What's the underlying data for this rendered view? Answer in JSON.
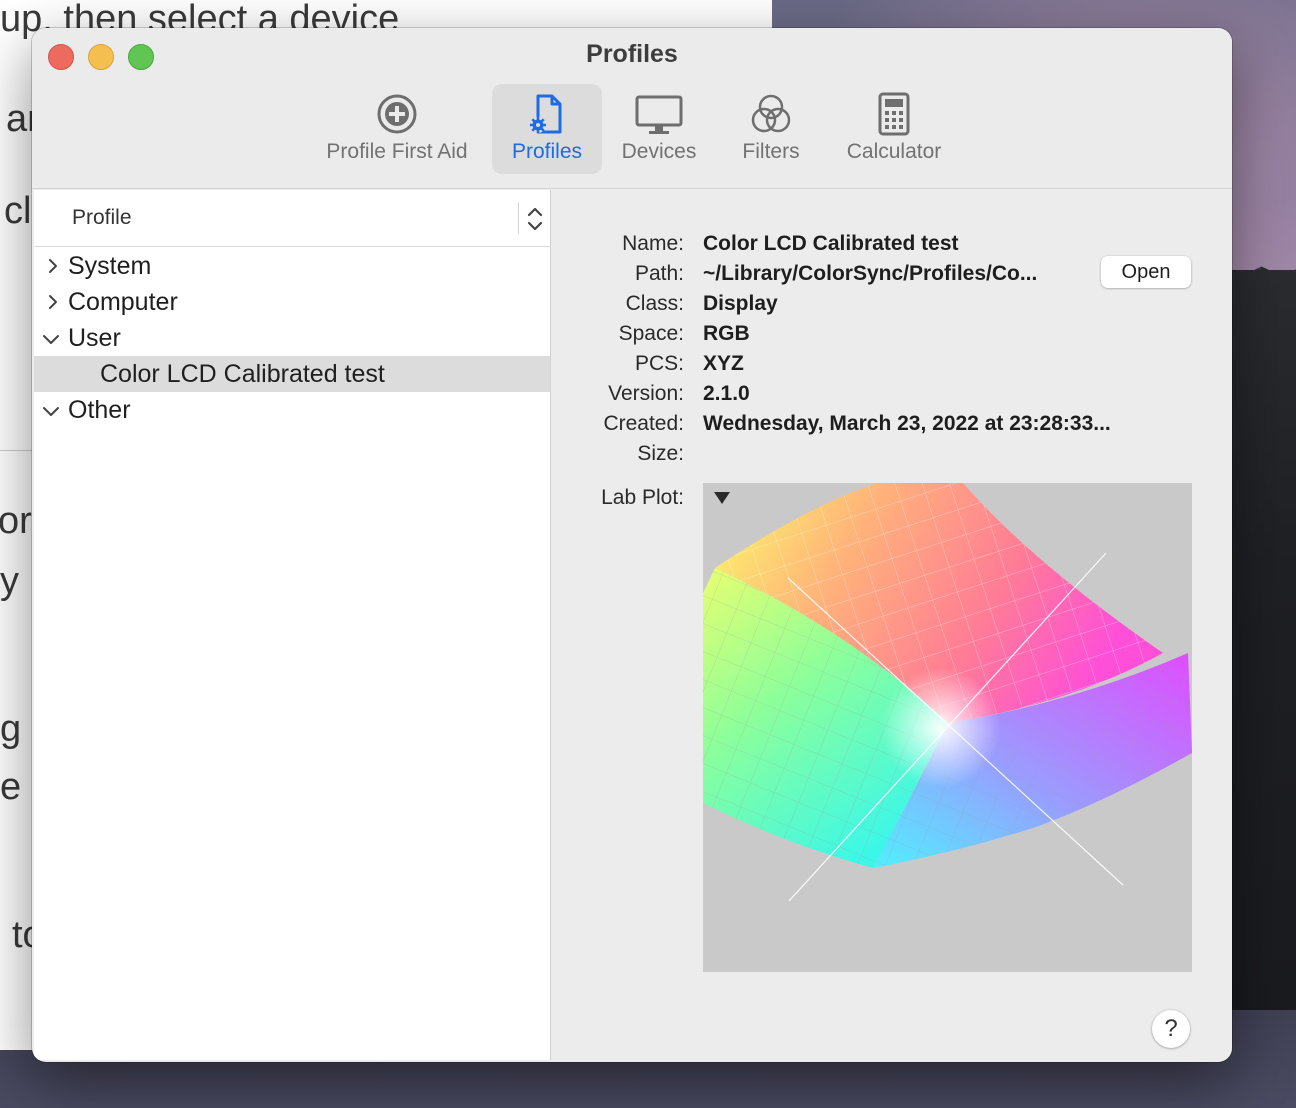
{
  "background_window": {
    "text_fragments": [
      "up, then select a device",
      "ar",
      "cl",
      "orc",
      "y",
      "g",
      "e",
      "to"
    ]
  },
  "window": {
    "title": "Profiles",
    "controls": {
      "close": "close-button",
      "minimize": "minimize-button",
      "zoom": "zoom-button"
    }
  },
  "toolbar": {
    "items": [
      {
        "label": "Profile First Aid",
        "icon": "first-aid-icon",
        "selected": false
      },
      {
        "label": "Profiles",
        "icon": "profile-document-icon",
        "selected": true
      },
      {
        "label": "Devices",
        "icon": "display-icon",
        "selected": false
      },
      {
        "label": "Filters",
        "icon": "filters-icon",
        "selected": false
      },
      {
        "label": "Calculator",
        "icon": "calculator-icon",
        "selected": false
      }
    ]
  },
  "profile_list": {
    "header": "Profile",
    "rows": [
      {
        "label": "System",
        "expanded": false
      },
      {
        "label": "Computer",
        "expanded": false
      },
      {
        "label": "User",
        "expanded": true
      },
      {
        "label": "Color LCD Calibrated test",
        "selected": true
      },
      {
        "label": "Other",
        "expanded": true
      }
    ]
  },
  "details": {
    "name_label": "Name:",
    "name_value": "Color LCD Calibrated test",
    "path_label": "Path:",
    "path_value": "~/Library/ColorSync/Profiles/Co...",
    "open_button": "Open",
    "class_label": "Class:",
    "class_value": "Display",
    "space_label": "Space:",
    "space_value": "RGB",
    "pcs_label": "PCS:",
    "pcs_value": "XYZ",
    "version_label": "Version:",
    "version_value": "2.1.0",
    "created_label": "Created:",
    "created_value": "Wednesday, March 23, 2022 at 23:28:33...",
    "size_label": "Size:",
    "size_value": "",
    "lab_plot_label": "Lab Plot:"
  },
  "help_button": "?",
  "colors": {
    "accent": "#1f6be3",
    "close": "#ed6a5e",
    "minimize": "#f5bf4f",
    "zoom": "#61c554",
    "plot_background": "#c9c9c9"
  }
}
